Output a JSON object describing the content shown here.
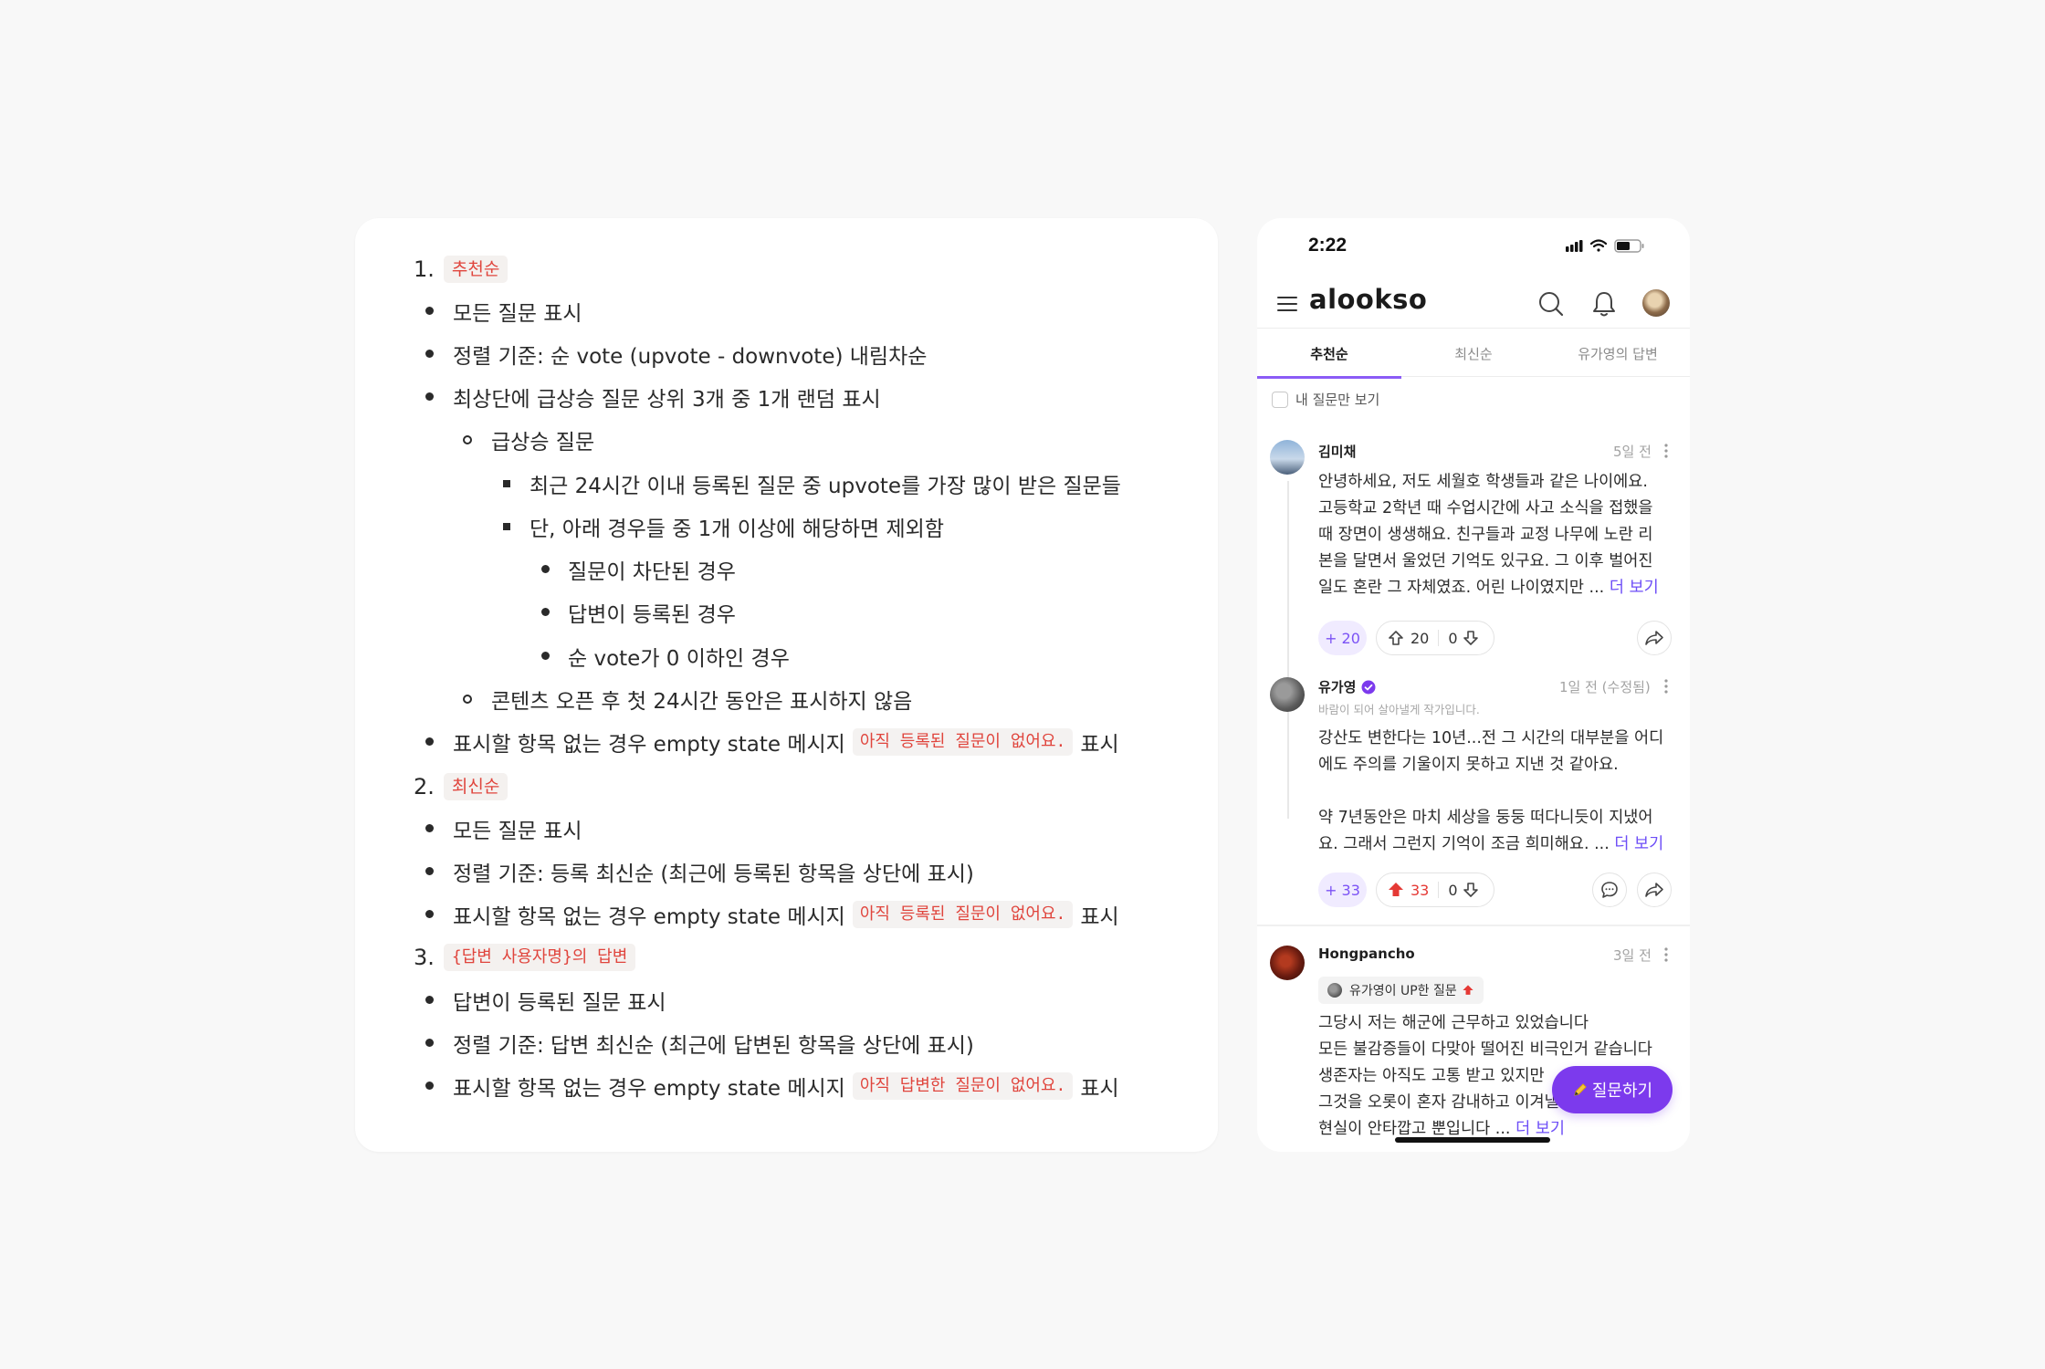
{
  "spec": {
    "sections": [
      {
        "number": "1.",
        "tag": "추천순",
        "items": [
          {
            "text": "모든 질문 표시"
          },
          {
            "text": "정렬 기준: 순 vote (upvote - downvote) 내림차순"
          },
          {
            "text": "최상단에 급상승 질문 상위 3개 중 1개 랜덤 표시"
          },
          {
            "text": "급상승 질문"
          },
          {
            "text": "최근 24시간 이내 등록된 질문 중 upvote를 가장 많이 받은 질문들"
          },
          {
            "text": "단, 아래 경우들 중 1개 이상에 해당하면 제외함"
          },
          {
            "text": "질문이 차단된 경우"
          },
          {
            "text": "답변이 등록된 경우"
          },
          {
            "text": "순 vote가 0 이하인 경우"
          },
          {
            "text": "콘텐츠 오픈 후 첫 24시간 동안은 표시하지 않음"
          },
          {
            "pre": "표시할 항목 없는 경우 empty state 메시지",
            "code": "아직 등록된 질문이 없어요.",
            "post": "표시"
          }
        ]
      },
      {
        "number": "2.",
        "tag": "최신순",
        "items": [
          {
            "text": "모든 질문 표시"
          },
          {
            "text": "정렬 기준: 등록 최신순 (최근에 등록된 항목을 상단에 표시)"
          },
          {
            "pre": "표시할 항목 없는 경우 empty state 메시지",
            "code": "아직 등록된 질문이 없어요.",
            "post": "표시"
          }
        ]
      },
      {
        "number": "3.",
        "tag": "{답변 사용자명}의 답변",
        "items": [
          {
            "text": "답변이 등록된 질문 표시"
          },
          {
            "text": "정렬 기준: 답변 최신순 (최근에 답변된 항목을 상단에 표시)"
          },
          {
            "pre": "표시할 항목 없는 경우 empty state 메시지",
            "code": "아직 답변한 질문이 없어요.",
            "post": "표시"
          }
        ]
      }
    ]
  },
  "phone": {
    "status_time": "2:22",
    "app_name": "alookso",
    "tabs": [
      {
        "label": "추천순",
        "active": true
      },
      {
        "label": "최신순",
        "active": false
      },
      {
        "label": "유가영의 답변",
        "active": false
      }
    ],
    "filter_label": "내 질문만 보기",
    "posts": [
      {
        "author": "김미채",
        "time": "5일 전",
        "lines": [
          "안녕하세요, 저도 세월호 학생들과 같은 나이에요.",
          "고등학교 2학년 때 수업시간에 사고 소식을 접했을",
          "때 장면이 생생해요. 친구들과 교정 나무에 노란 리",
          "본을 달면서 울었던 기억도 있구요. 그 이후 벌어진",
          "일도 혼란 그 자체였죠. 어린 나이였지만 ..."
        ],
        "more_label": "더 보기",
        "plus_label": "+ 20",
        "up_count": "20",
        "down_count": "0"
      },
      {
        "author": "유가영",
        "subtitle": "바람이 되어 살아낼게 작가입니다.",
        "time": "1일 전 (수정됨)",
        "lines": [
          "강산도 변한다는 10년...전 그 시간의 대부분을 어디",
          "에도 주의를 기울이지 못하고 지낸 것 같아요.",
          "",
          "약 7년동안은 마치 세상을 둥둥 떠다니듯이 지냈어",
          "요. 그래서 그런지 기억이 조금 희미해요. ..."
        ],
        "more_label": "더 보기",
        "plus_label": "+ 33",
        "up_count": "33",
        "down_count": "0"
      },
      {
        "author": "Hongpancho",
        "time": "3일 전",
        "badge": "유가영이 UP한 질문",
        "lines": [
          "그당시 저는 해군에 근무하고 있었습니다",
          "모든 불감증들이 다맞아 떨어진 비극인거 같습니다",
          "생존자는 아직도 고통 받고 있지만",
          "그것을 오롯이 혼자 감내하고 이겨낼",
          "현실이 안타깝고 뿐입니다 ..."
        ],
        "more_label": "더 보기"
      }
    ],
    "fab_label": "질문하기",
    "colors": {
      "accent": "#7c3aed",
      "upvoted": "#e53935",
      "code_text": "#e0453d"
    }
  }
}
